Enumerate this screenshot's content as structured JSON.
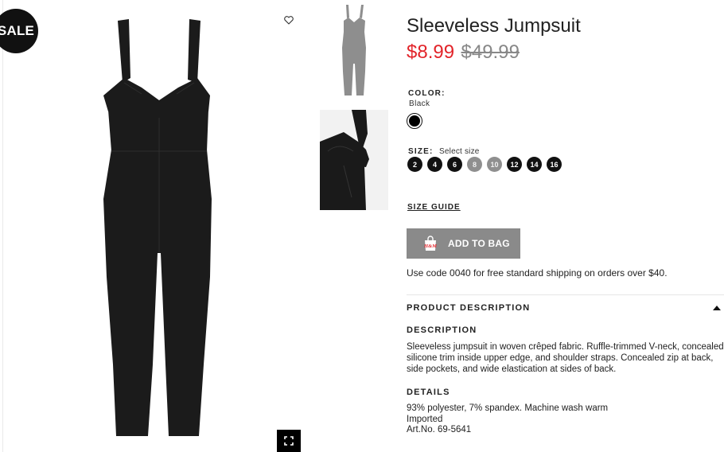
{
  "badge": {
    "label": "SALE"
  },
  "product": {
    "title": "Sleeveless Jumpsuit",
    "price_sale": "$8.99",
    "price_original": "$49.99"
  },
  "color": {
    "label": "COLOR:",
    "value": "Black",
    "swatch_color": "#000000"
  },
  "size": {
    "label": "SIZE:",
    "hint": "Select size",
    "options": [
      {
        "label": "2",
        "available": true
      },
      {
        "label": "4",
        "available": true
      },
      {
        "label": "6",
        "available": true
      },
      {
        "label": "8",
        "available": false
      },
      {
        "label": "10",
        "available": false
      },
      {
        "label": "12",
        "available": true
      },
      {
        "label": "14",
        "available": true
      },
      {
        "label": "16",
        "available": true
      }
    ]
  },
  "size_guide": {
    "label": "SIZE GUIDE"
  },
  "add_to_bag": {
    "label": "ADD TO BAG",
    "icon": "hm-bag-icon"
  },
  "shipping_note": "Use code 0040 for free standard shipping on orders over $40.",
  "product_description": {
    "header": "PRODUCT DESCRIPTION",
    "description_label": "DESCRIPTION",
    "description_text": "Sleeveless jumpsuit in woven crêped fabric. Ruffle-trimmed V-neck, concealed silicone trim inside upper edge, and shoulder straps. Concealed zip at back, side pockets, and wide elastication at sides of back.",
    "details_label": "DETAILS",
    "details": [
      "93% polyester, 7% spandex. Machine wash warm",
      "Imported",
      "Art.No. 69-5641"
    ]
  },
  "colors": {
    "sale_price": "#e2242a",
    "button_bg": "#8a8a8a",
    "badge_bg": "#111111"
  }
}
